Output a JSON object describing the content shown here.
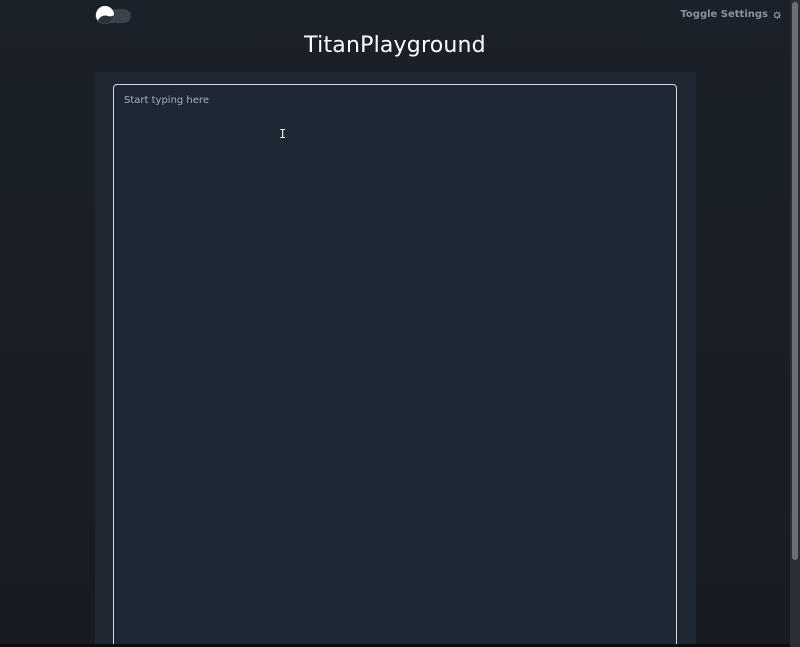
{
  "header": {
    "theme_toggle": {
      "state": "dark",
      "icon": "half-moon-icon"
    },
    "settings_label": "Toggle Settings",
    "settings_icon": "gear-icon"
  },
  "title": "TitanPlayground",
  "editor": {
    "placeholder": "Start typing here",
    "value": ""
  },
  "colors": {
    "background": "#1a1e26",
    "panel": "#1f2733",
    "editor_border": "#d6dae0",
    "title_text": "#ffffff",
    "muted_text": "#8a929c"
  }
}
